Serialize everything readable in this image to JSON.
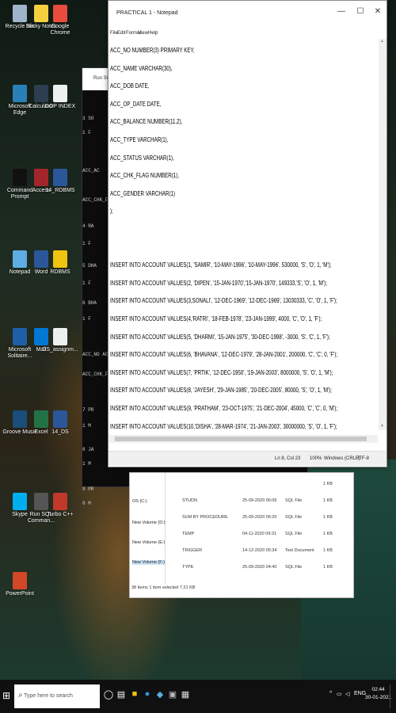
{
  "desktop": {
    "icons": [
      {
        "label": "Recycle Bin",
        "color": "#9fb4c8"
      },
      {
        "label": "Sticky Notes",
        "color": "#f4d03f"
      },
      {
        "label": "Google Chrome",
        "color": "#e74c3c"
      },
      {
        "label": "Microsoft Edge",
        "color": "#2980b9"
      },
      {
        "label": "Calculator",
        "color": "#2c3e50"
      },
      {
        "label": "DOP INDEX",
        "color": "#ecf0f1"
      },
      {
        "label": "Command Prompt",
        "color": "#111111"
      },
      {
        "label": "Access",
        "color": "#a4262c"
      },
      {
        "label": "14_RDBMS",
        "color": "#2b579a"
      },
      {
        "label": "Notepad",
        "color": "#5dade2"
      },
      {
        "label": "Word",
        "color": "#2b579a"
      },
      {
        "label": "RDBMS",
        "color": "#f1c40f"
      },
      {
        "label": "Microsoft Solitaire...",
        "color": "#1e5fa8"
      },
      {
        "label": "Mail",
        "color": "#0078d4"
      },
      {
        "label": "DS_assignm...",
        "color": "#ecf0f1"
      },
      {
        "label": "Groove Music",
        "color": "#1a4d7a"
      },
      {
        "label": "Excel",
        "color": "#217346"
      },
      {
        "label": "14_DS",
        "color": "#2b579a"
      },
      {
        "label": "Skype",
        "color": "#00aff0"
      },
      {
        "label": "Run SQL Comman...",
        "color": "#555555"
      },
      {
        "label": "Turbo C++",
        "color": "#c0392b"
      },
      {
        "label": "PowerPoint",
        "color": "#d24726"
      }
    ]
  },
  "sql_window": {
    "title": "Run SQL Comm",
    "lines": [
      "3 SO",
      "1 F",
      "ACC_AC",
      "ACC_CHK_FLAG",
      "4 RA",
      "1 F",
      "5 DHA",
      "1 F",
      "6 BHA",
      "1 F",
      "ACC_NO ACC",
      "ACC_CHK_FLAG",
      "7 PR",
      "1 M",
      "8 JA",
      "1 M",
      "9 PR",
      "0 M"
    ]
  },
  "explorer": {
    "sidebar": [
      "OS (C:)",
      "New Volume (D:)",
      "New Volume (E:)",
      "New Volume (F:)"
    ],
    "rows": [
      {
        "name": "",
        "date": "",
        "type": "",
        "size": "1 KB"
      },
      {
        "name": "STUDN",
        "date": "25-09-2020 06:06",
        "type": "SQL File",
        "size": "1 KB"
      },
      {
        "name": "SUM BY PROCEDURE",
        "date": "25-09-2020 06:20",
        "type": "SQL File",
        "size": "1 KB"
      },
      {
        "name": "TEMP",
        "date": "04-11-2020 09:31",
        "type": "SQL File",
        "size": "1 KB"
      },
      {
        "name": "TRIGGER",
        "date": "14-12-2020 05:34",
        "type": "Text Document",
        "size": "1 KB"
      },
      {
        "name": "TYPE",
        "date": "25-09-2020 04:40",
        "type": "SQL File",
        "size": "1 KB"
      }
    ],
    "status": "38 items    1 item selected  7.21 KB"
  },
  "notepad": {
    "title": "PRACTICAL 1 - Notepad",
    "menu": [
      "File",
      "Edit",
      "Format",
      "View",
      "Help"
    ],
    "controls": {
      "minimize": "—",
      "maximize": "☐",
      "close": "✕"
    },
    "lines": [
      "ACC_NO NUMBER(3) PRIMARY KEY,",
      "ACC_NAME VARCHAR(30),",
      "ACC_DOB DATE,",
      "ACC_OP_DATE DATE,",
      "ACC_BALANCE NUMBER(11,2),",
      "ACC_TYPE VARCHAR(1),",
      "ACC_STATUS VARCHAR(1),",
      "ACC_CHK_FLAG NUMBER(1),",
      "ACC_GENDER VARCHAR(1)",
      ");",
      "",
      "",
      "INSERT INTO ACCOUNT VALUES(1, 'SAMIR', '10-MAY-1996', '10-MAY-1996', 530000, 'S', 'O', 1, 'M');",
      "INSERT INTO ACCOUNT VALUES(2, 'DIPEN', '15-JAN-1970','15-JAN-1970', 149333,'S', 'O', 1, 'M');",
      "INSERT INTO ACCOUNT VALUES(3,SONALI', '12-DEC-1969', '12-DEC-1969', 13030333, 'C', 'O', 1, 'F');",
      "INSERT INTO ACCOUNT VALUES(4,'RATRI', '18-FEB-1978', '23-JAN-1999', 4000, 'C', 'O', 1, 'F');",
      "INSERT INTO ACCOUNT VALUES(5, 'DHARMI', '15-JAN-1975', '30-DEC-1998', -3000, 'S', 'C', 1, 'F');",
      "INSERT INTO ACCOUNT VALUES(6, 'BHAVANA', '12-DEC-1979', '28-JAN-2001', 200000, 'C', 'C', 0, 'F');",
      "INSERT INTO ACCOUNT VALUES(7, 'PRTIK', '12-DEC-1950', '19-JAN-2003', 8000000, 'S', 'O', 1, 'M');",
      "INSERT INTO ACCOUNT VALUES(8, 'JAYESH', '29-JAN-1985', '20-DEC-2005', 80000, 'S', 'O', 1, 'M');",
      "INSERT INTO ACCOUNT VALUES(9, 'PRATHAM', '23-OCT-1975', '21-DEC-2004', 45000, 'C', 'C', 0, 'M');",
      "INSERT INTO ACCOUNT VALUES(10,'DISHA', '28-MAR-1974', '21-JAN-2003', 30000000, 'S', 'O', 1, 'F');"
    ],
    "status": {
      "position": "Ln 8, Col 23",
      "zoom": "100%",
      "line_ending": "Windows (CRLF)",
      "encoding": "UTF-8"
    }
  },
  "taskbar": {
    "search_placeholder": "Type here to search",
    "apps": [
      "task-view",
      "file-explorer",
      "chrome",
      "edge",
      "sql",
      "notepad"
    ],
    "tray": {
      "chevron": "^",
      "lang": "ENG"
    },
    "clock": {
      "time": "02:44",
      "date": "30-01-2021"
    }
  }
}
